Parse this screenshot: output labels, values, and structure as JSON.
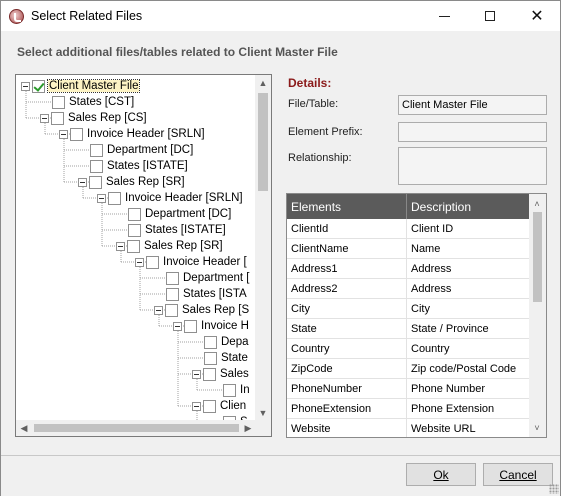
{
  "window": {
    "title": "Select Related Files"
  },
  "subtitle": "Select additional files/tables related to Client Master File",
  "tree": {
    "nodes": [
      {
        "label": "Client Master File",
        "depth": 0,
        "expander": true,
        "checked": true,
        "selected": true
      },
      {
        "label": "States [CST]",
        "depth": 1,
        "expander": false,
        "checked": false
      },
      {
        "label": "Sales Rep [CS]",
        "depth": 1,
        "expander": true,
        "checked": false
      },
      {
        "label": "Invoice Header [SRLN]",
        "depth": 2,
        "expander": true,
        "checked": false
      },
      {
        "label": "Department [DC]",
        "depth": 3,
        "expander": false,
        "checked": false
      },
      {
        "label": "States [ISTATE]",
        "depth": 3,
        "expander": false,
        "checked": false
      },
      {
        "label": "Sales Rep [SR]",
        "depth": 3,
        "expander": true,
        "checked": false
      },
      {
        "label": "Invoice Header [SRLN]",
        "depth": 4,
        "expander": true,
        "checked": false
      },
      {
        "label": "Department [DC]",
        "depth": 5,
        "expander": false,
        "checked": false
      },
      {
        "label": "States [ISTATE]",
        "depth": 5,
        "expander": false,
        "checked": false
      },
      {
        "label": "Sales Rep [SR]",
        "depth": 5,
        "expander": true,
        "checked": false
      },
      {
        "label": "Invoice Header [",
        "depth": 6,
        "expander": true,
        "checked": false
      },
      {
        "label": "Department [",
        "depth": 7,
        "expander": false,
        "checked": false
      },
      {
        "label": "States [ISTA",
        "depth": 7,
        "expander": false,
        "checked": false
      },
      {
        "label": "Sales Rep [S",
        "depth": 7,
        "expander": true,
        "checked": false
      },
      {
        "label": "Invoice H",
        "depth": 8,
        "expander": true,
        "checked": false
      },
      {
        "label": "Depa",
        "depth": 9,
        "expander": false,
        "checked": false
      },
      {
        "label": "State",
        "depth": 9,
        "expander": false,
        "checked": false
      },
      {
        "label": "Sales",
        "depth": 9,
        "expander": true,
        "checked": false
      },
      {
        "label": "In",
        "depth": 10,
        "expander": false,
        "checked": false
      },
      {
        "label": "Clien",
        "depth": 9,
        "expander": true,
        "checked": false
      },
      {
        "label": "S",
        "depth": 10,
        "expander": false,
        "checked": false
      }
    ]
  },
  "details": {
    "heading": "Details:",
    "file_table_label": "File/Table:",
    "file_table_value": "Client Master File",
    "element_prefix_label": "Element Prefix:",
    "element_prefix_value": "",
    "relationship_label": "Relationship:",
    "relationship_value": ""
  },
  "grid": {
    "columns": [
      "Elements",
      "Description"
    ],
    "rows": [
      [
        "ClientId",
        "Client ID"
      ],
      [
        "ClientName",
        "Name"
      ],
      [
        "Address1",
        "Address"
      ],
      [
        "Address2",
        "Address"
      ],
      [
        "City",
        "City"
      ],
      [
        "State",
        "State / Province"
      ],
      [
        "Country",
        "Country"
      ],
      [
        "ZipCode",
        "Zip code/Postal Code"
      ],
      [
        "PhoneNumber",
        "Phone Number"
      ],
      [
        "PhoneExtension",
        "Phone Extension"
      ],
      [
        "Website",
        "Website URL"
      ]
    ]
  },
  "buttons": {
    "ok": "Ok",
    "cancel": "Cancel"
  },
  "colors": {
    "details_heading": "#8b1a1a",
    "grid_header_bg": "#5b5b5b",
    "check_green": "#2a9a2a"
  }
}
